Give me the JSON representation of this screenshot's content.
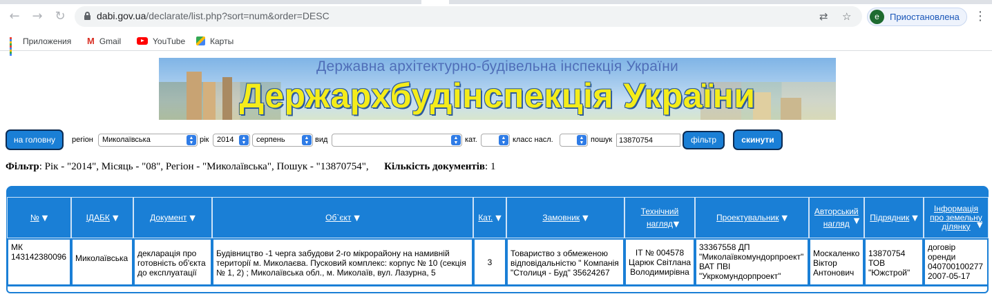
{
  "browser": {
    "url_host": "dabi.gov.ua",
    "url_path": "/declarate/list.php?sort=num&order=DESC",
    "profile_initial": "e",
    "profile_label": "Приостановлена"
  },
  "bookmarks": [
    {
      "label": "Приложения",
      "icon": "apps-grid-icon"
    },
    {
      "label": "Gmail",
      "icon": "gmail-icon"
    },
    {
      "label": "YouTube",
      "icon": "youtube-icon"
    },
    {
      "label": "Карты",
      "icon": "maps-icon"
    }
  ],
  "banner": {
    "line1": "Державна архітектурно-будівельна інспекція України",
    "line2": "Держархбудінспекція України"
  },
  "filters": {
    "home_button": "на головну",
    "region_label": "регіон",
    "region_value": "Миколаївська",
    "year_label": "рік",
    "year_value": "2014",
    "month_value": "серпень",
    "kind_label": "вид",
    "kind_value": "",
    "cat_label": "кат.",
    "cat_value": "",
    "class_label": "класс насл.",
    "class_value": "",
    "search_label": "пошук",
    "search_value": "13870754",
    "filter_button": "фільтр",
    "reset_button": "скинути"
  },
  "summary": {
    "filter_label": "Фільтр",
    "filter_text": ": Рік - \"2014\", Місяць - \"08\", Регіон - \"Миколаївська\", Пошук - \"13870754\",",
    "count_label": "Кількість документів",
    "count_value": ": 1"
  },
  "table": {
    "headers": [
      "№",
      "ІДАБК",
      "Документ",
      "Об`єкт",
      "Кат.",
      "Замовник",
      "Технічний нагляд",
      "Проектувальник",
      "Авторський нагляд",
      "Підрядник",
      "Інформація про земельну ділянку"
    ],
    "rows": [
      {
        "num": "МК 143142380096",
        "idabk": "Миколаївська",
        "document": "декларація про готовність об'єкта до експлуатації",
        "object": "Будівництво -1 черга забудови 2-го мікрорайону на намивній території м. Миколаєва. Пусковий комплекс: корпус № 10 (секція № 1, 2) ; Миколаївська обл., м. Миколаїв, вул. Лазурна, 5",
        "cat": "3",
        "customer": "Товариство з обмеженою відповідальністю \" Компанія \"Столиця - Буд\" 35624267",
        "tech_supervision": "ІТ № 004578 Царюк Світлана Володимирівна",
        "designer": "33367558 ДП \"Миколаївкомундорпроект\" ВАТ ПВІ \"Укркомундорпроект\"",
        "author_supervision": "Москаленко Віктор Антонович",
        "contractor": "13870754 ТОВ \"Южстрой\"",
        "land_info": "договір оренди 040700100277 2007-05-17"
      }
    ]
  }
}
